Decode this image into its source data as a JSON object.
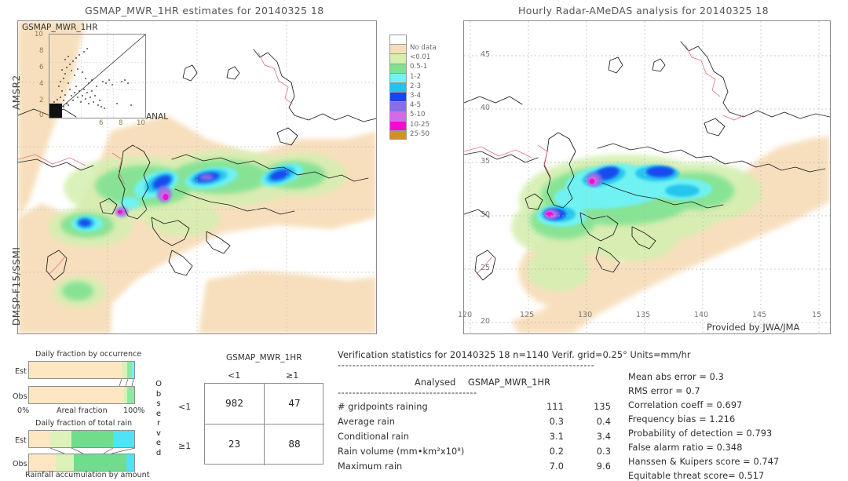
{
  "left_panel": {
    "title": "GSMAP_MWR_1HR estimates for 20140325 18",
    "inset_title": "GSMAP_MWR_1HR",
    "inset_xlabel": "ANAL",
    "inset_ticks": [
      "0",
      "2",
      "4",
      "6",
      "8",
      "10"
    ],
    "axis_label_top": "AMSR2",
    "axis_label_bottom": "DMSP-F15/SSMI"
  },
  "right_panel": {
    "title": "Hourly Radar-AMeDAS analysis for 20140325 18",
    "credit": "Provided by JWA/JMA",
    "lon_ticks": [
      "120",
      "125",
      "130",
      "135",
      "140",
      "145",
      "15"
    ],
    "lat_ticks": [
      "45",
      "40",
      "35",
      "30",
      "25",
      "20"
    ]
  },
  "legend": {
    "labels": [
      "No data",
      "<0.01",
      "0.5-1",
      "1-2",
      "2-3",
      "3-4",
      "4-5",
      "5-10",
      "10-25",
      "25-50"
    ],
    "colors": [
      "#ffffff",
      "#f7debb",
      "#d4efb0",
      "#7fe292",
      "#6ff3f7",
      "#23c3ef",
      "#1745ee",
      "#8a6de8",
      "#d36ae8",
      "#f50ad0",
      "#cf922a"
    ]
  },
  "occurrence_chart": {
    "title": "Daily fraction by occurrence",
    "row_labels": [
      "Est",
      "Obs"
    ],
    "x_left": "0%",
    "x_center": "Areal fraction",
    "x_right": "100%",
    "est_segments": [
      {
        "color": "#fce7c2",
        "pct": 88.5
      },
      {
        "color": "#d8f0b4",
        "pct": 4.5
      },
      {
        "color": "#8fe7a4",
        "pct": 5.0
      },
      {
        "color": "#6ff3f7",
        "pct": 2.0
      }
    ],
    "obs_segments": [
      {
        "color": "#fce7c2",
        "pct": 90.0
      },
      {
        "color": "#d8f0b4",
        "pct": 3.5
      },
      {
        "color": "#8fe7a4",
        "pct": 6.5
      }
    ]
  },
  "totalrain_chart": {
    "title": "Daily fraction of total rain",
    "caption": "Rainfall accumulation by amount",
    "row_labels": [
      "Est",
      "Obs"
    ],
    "est_segments": [
      {
        "color": "#fce7c2",
        "pct": 20.0
      },
      {
        "color": "#ddf2b8",
        "pct": 20.0
      },
      {
        "color": "#6fdd8c",
        "pct": 40.0
      },
      {
        "color": "#4de4f5",
        "pct": 20.0
      }
    ],
    "obs_segments": [
      {
        "color": "#fce7c2",
        "pct": 20.0
      },
      {
        "color": "#ddf2b8",
        "pct": 14.0
      },
      {
        "color": "#6fdd8c",
        "pct": 40.0
      },
      {
        "color": "#4de4f5",
        "pct": 6.0
      }
    ]
  },
  "contingency": {
    "title": "GSMAP_MWR_1HR",
    "col_headers": [
      "<1",
      "≧1"
    ],
    "col_headers_disp": [
      "<1",
      "≥1"
    ],
    "row_headers": [
      "<1",
      "≥1"
    ],
    "side_label": "Observed",
    "cells": [
      [
        "982",
        "47"
      ],
      [
        "23",
        "88"
      ]
    ]
  },
  "verification": {
    "header": "Verification statistics for 20140325 18   n=1140   Verif. grid=0.25°   Units=mm/hr",
    "divider": "----------------------------------------------------------------------",
    "col_header_left": "Analysed",
    "col_header_right": "GSMAP_MWR_1HR",
    "divider2": "--------------------------------------",
    "rows": [
      {
        "label": "# gridpoints raining",
        "analysed": "111",
        "estimate": "135"
      },
      {
        "label": "Average rain",
        "analysed": "0.3",
        "estimate": "0.4"
      },
      {
        "label": "Conditional rain",
        "analysed": "3.1",
        "estimate": "3.4"
      },
      {
        "label": "Rain volume (mm•km²x10⁸)",
        "analysed": "0.2",
        "estimate": "0.3"
      },
      {
        "label": "Maximum rain",
        "analysed": "7.0",
        "estimate": "9.6"
      }
    ],
    "scores": [
      "Mean abs error = 0.3",
      "RMS error = 0.7",
      "Correlation coeff = 0.697",
      "Frequency bias = 1.216",
      "Probability of detection = 0.793",
      "False alarm ratio = 0.348",
      "Hanssen & Kuipers score = 0.747",
      "Equitable threat score= 0.517"
    ]
  }
}
